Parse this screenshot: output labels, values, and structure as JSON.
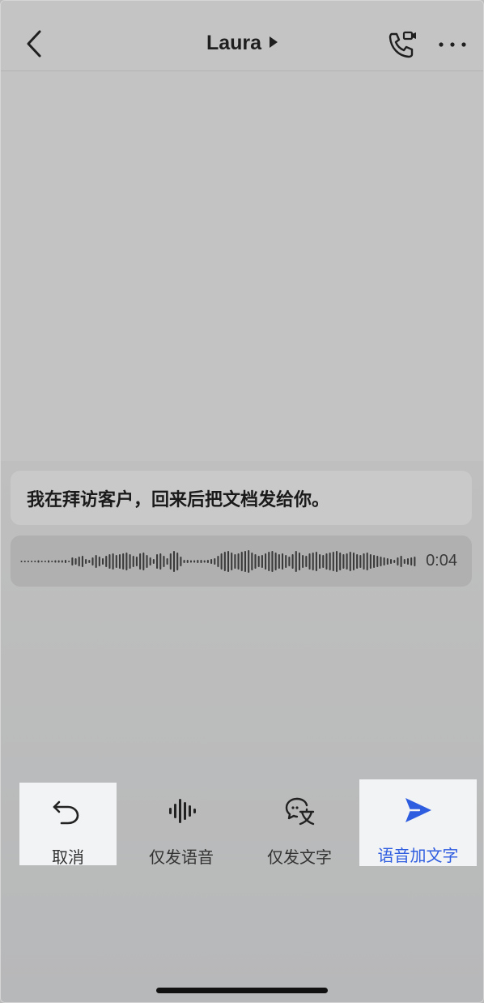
{
  "header": {
    "contact_name": "Laura",
    "icons": [
      "back-arrow-icon",
      "phone-video-icon",
      "more-dots-icon"
    ]
  },
  "transcript": {
    "text": "我在拜访客户，回来后把文档发给你。"
  },
  "voice_message": {
    "duration": "0:04"
  },
  "actions": {
    "cancel_label": "取消",
    "voice_only_label": "仅发语音",
    "text_only_label": "仅发文字",
    "voice_and_text_label": "语音加文字"
  },
  "colors": {
    "accent": "#2f5de0",
    "dim_background": "#c2c2c2"
  }
}
